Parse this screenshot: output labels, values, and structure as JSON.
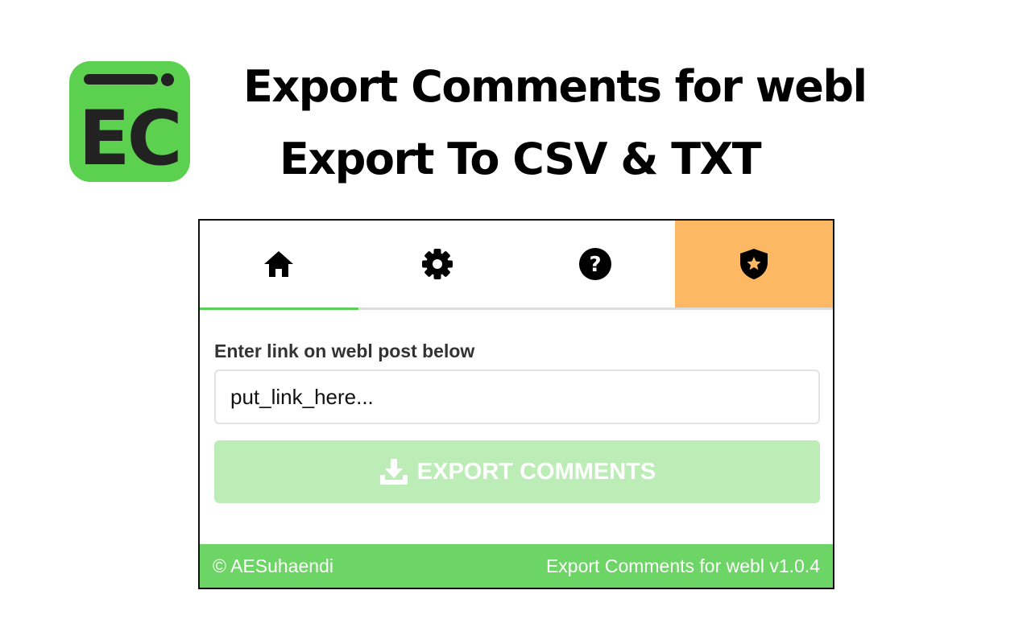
{
  "banner": {
    "logo_text": "EC",
    "title_line1": "Export Comments for webl",
    "title_line2": "Export To CSV & TXT"
  },
  "tabs": [
    {
      "icon": "home-icon",
      "active": true
    },
    {
      "icon": "gear-icon",
      "active": false
    },
    {
      "icon": "help-icon",
      "active": false
    },
    {
      "icon": "shield-star-icon",
      "active": false,
      "highlighted": true
    }
  ],
  "form": {
    "label": "Enter link on webl post below",
    "input_value": "",
    "input_placeholder": "put_link_here...",
    "export_label": "EXPORT COMMENTS"
  },
  "footer": {
    "copyright": "© AESuhaendi",
    "version": "Export Comments for webl v1.0.4"
  },
  "colors": {
    "accent_green": "#6cd565",
    "button_green_disabled": "#bdedb7",
    "tab_highlight": "#fdb864",
    "active_tab_underline": "#5cce5a"
  }
}
